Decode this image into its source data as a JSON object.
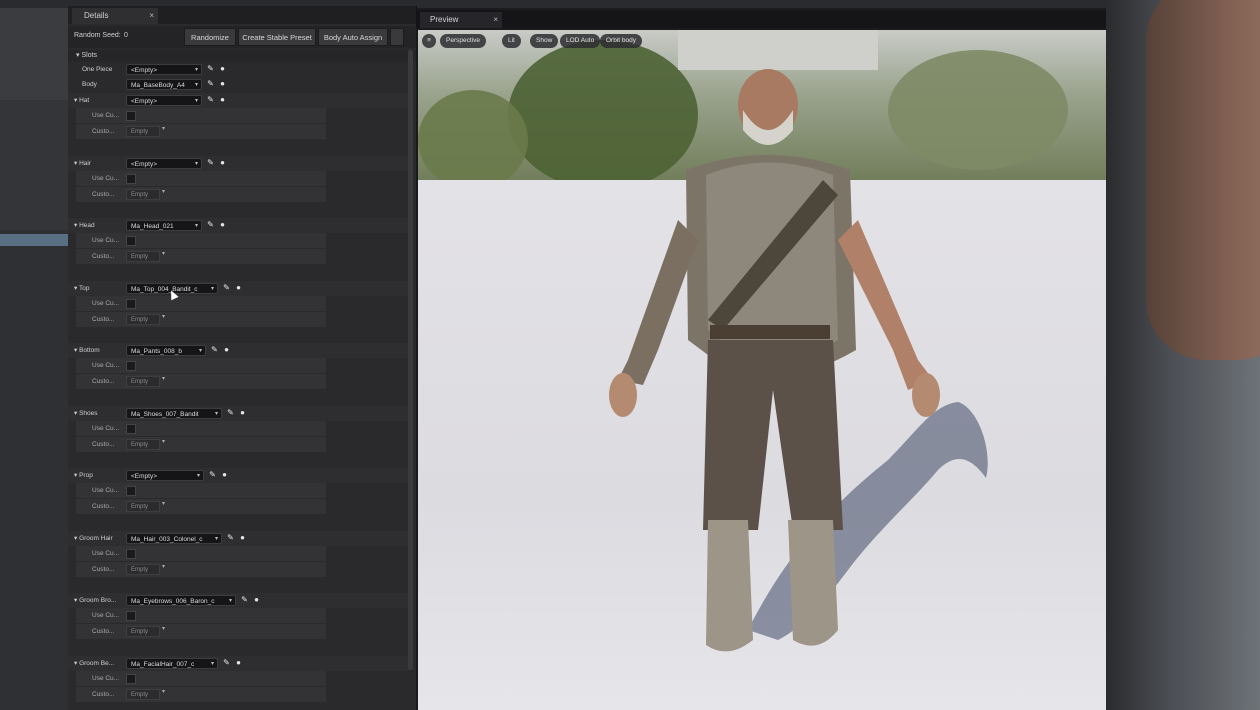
{
  "details": {
    "tab_title": "Details",
    "random_seed_label": "Random Seed:",
    "random_seed_value": "0",
    "buttons": [
      "Randomize",
      "Create Stable Preset",
      "Body Auto Assign"
    ],
    "slots_header": "Slots",
    "one_piece": {
      "label": "One Piece",
      "value": "<Empty>"
    },
    "body": {
      "label": "Body",
      "value": "Ma_BaseBody_A4"
    },
    "categories": [
      {
        "label": "Hat",
        "value": "<Empty>"
      },
      {
        "label": "Hair",
        "value": "<Empty>"
      },
      {
        "label": "Head",
        "value": "Ma_Head_021"
      },
      {
        "label": "Top",
        "value": "Ma_Top_004_Bandit_c"
      },
      {
        "label": "Bottom",
        "value": "Ma_Pants_008_b"
      },
      {
        "label": "Shoes",
        "value": "Ma_Shoes_007_Bandit"
      },
      {
        "label": "Prop",
        "value": "<Empty>"
      },
      {
        "label": "Groom Hair",
        "value": "Ma_Hair_003_Colonel_c"
      },
      {
        "label": "Groom Bro...",
        "value": "Ma_Eyebrows_006_Baron_c"
      },
      {
        "label": "Groom Be...",
        "value": "Ma_FacialHair_007_c"
      }
    ],
    "sub_use": "Use Cu...",
    "sub_custom": "Custo...",
    "empty_text": "Empty"
  },
  "preview": {
    "tab_title": "Preview",
    "toolbar": [
      "Perspective",
      "Lit",
      "Show",
      "LOD Auto",
      "Orbit body"
    ]
  }
}
